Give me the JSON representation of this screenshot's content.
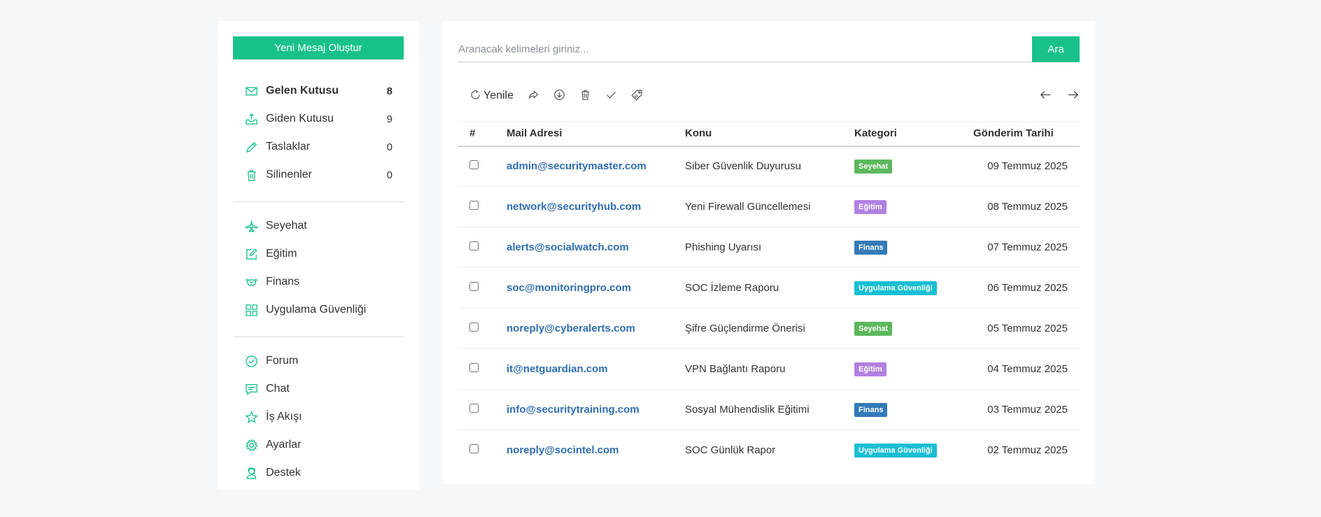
{
  "sidebar": {
    "new_message_label": "Yeni Mesaj Oluştur",
    "folders": [
      {
        "label": "Gelen Kutusu",
        "count": "8",
        "icon": "envelope-icon"
      },
      {
        "label": "Giden Kutusu",
        "count": "9",
        "icon": "outbox-tray-icon"
      },
      {
        "label": "Taslaklar",
        "count": "0",
        "icon": "pencil-icon"
      },
      {
        "label": "Silinenler",
        "count": "0",
        "icon": "trash-icon"
      }
    ],
    "categories": [
      {
        "label": "Seyehat",
        "icon": "airplane-icon"
      },
      {
        "label": "Eğitim",
        "icon": "edit-note-icon"
      },
      {
        "label": "Finans",
        "icon": "handshake-icon"
      },
      {
        "label": "Uygulama Güvenliği",
        "icon": "apps-grid-icon"
      }
    ],
    "other": [
      {
        "label": "Forum",
        "icon": "check-circle-icon"
      },
      {
        "label": "Chat",
        "icon": "chat-bubble-icon"
      },
      {
        "label": "İş Akışı",
        "icon": "star-icon"
      },
      {
        "label": "Ayarlar",
        "icon": "gear-icon"
      },
      {
        "label": "Destek",
        "icon": "support-agent-icon"
      }
    ]
  },
  "search": {
    "placeholder": "Aranacak kelimeleri giriniz...",
    "button_label": "Ara"
  },
  "toolbar": {
    "refresh_label": "Yenile"
  },
  "table": {
    "headers": {
      "num": "#",
      "mail": "Mail Adresi",
      "subject": "Konu",
      "category": "Kategori",
      "date": "Gönderim Tarihi"
    },
    "rows": [
      {
        "mail": "admin@securitymaster.com",
        "subject": "Siber Güvenlik Duyurusu",
        "category": "Seyehat",
        "date": "09 Temmuz 2025"
      },
      {
        "mail": "network@securityhub.com",
        "subject": "Yeni Firewall Güncellemesi",
        "category": "Eğitim",
        "date": "08 Temmuz 2025"
      },
      {
        "mail": "alerts@socialwatch.com",
        "subject": "Phishing Uyarısı",
        "category": "Finans",
        "date": "07 Temmuz 2025"
      },
      {
        "mail": "soc@monitoringpro.com",
        "subject": "SOC İzleme Raporu",
        "category": "Uygulama Güvenliği",
        "date": "06 Temmuz 2025"
      },
      {
        "mail": "noreply@cyberalerts.com",
        "subject": "Şifre Güçlendirme Önerisi",
        "category": "Seyehat",
        "date": "05 Temmuz 2025"
      },
      {
        "mail": "it@netguardian.com",
        "subject": "VPN Bağlantı Raporu",
        "category": "Eğitim",
        "date": "04 Temmuz 2025"
      },
      {
        "mail": "info@securitytraining.com",
        "subject": "Sosyal Mühendislik Eğitimi",
        "category": "Finans",
        "date": "03 Temmuz 2025"
      },
      {
        "mail": "noreply@socintel.com",
        "subject": "SOC Günlük Rapor",
        "category": "Uygulama Güvenliği",
        "date": "02 Temmuz 2025"
      }
    ]
  },
  "colors": {
    "accent": "#19c18a",
    "link": "#2f6eb0",
    "badge_seyehat": "#5cb85c",
    "badge_egitim": "#b181e0",
    "badge_finans": "#337ab7",
    "badge_uygulama": "#17bfd3"
  }
}
